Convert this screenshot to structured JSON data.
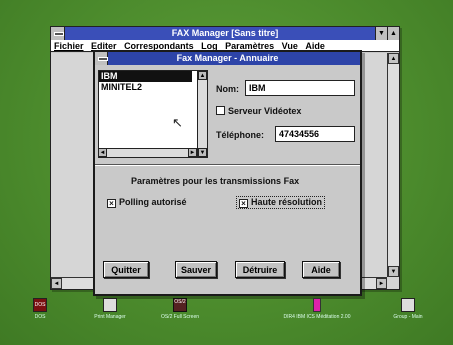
{
  "main_window": {
    "title": "FAX Manager [Sans titre]",
    "menu": [
      "Fichier",
      "Editer",
      "Correspondants",
      "Log",
      "Paramètres",
      "Vue",
      "Aide"
    ]
  },
  "dialog": {
    "title": "Fax Manager - Annuaire",
    "list_items": [
      "IBM",
      "MINITEL2"
    ],
    "selected_item": "IBM",
    "nom_label": "Nom:",
    "nom_value": "IBM",
    "serveur_label": "Serveur Vidéotex",
    "serveur_checked": false,
    "telephone_label": "Téléphone:",
    "telephone_value": "47434556",
    "params_heading": "Paramètres pour les transmissions Fax",
    "polling_label": "Polling autorisé",
    "polling_checked": true,
    "haute_label": "Haute résolution",
    "haute_checked": true,
    "buttons": {
      "quitter": "Quitter",
      "sauver": "Sauver",
      "detruire": "Détruire",
      "aide": "Aide"
    }
  },
  "taskbar": [
    {
      "label": "DOS",
      "icon": "dos-icon"
    },
    {
      "label": "Print Manager",
      "icon": "printer-icon"
    },
    {
      "label": "OS/2 Full Screen",
      "icon": "os2-icon"
    },
    {
      "label": "DIR4 IBM ICS Méditation 2.00",
      "icon": "program-icon"
    },
    {
      "label": "Group - Main",
      "icon": "group-icon"
    }
  ],
  "icon_texts": {
    "dos": "DOS",
    "os2": "OS/2"
  }
}
